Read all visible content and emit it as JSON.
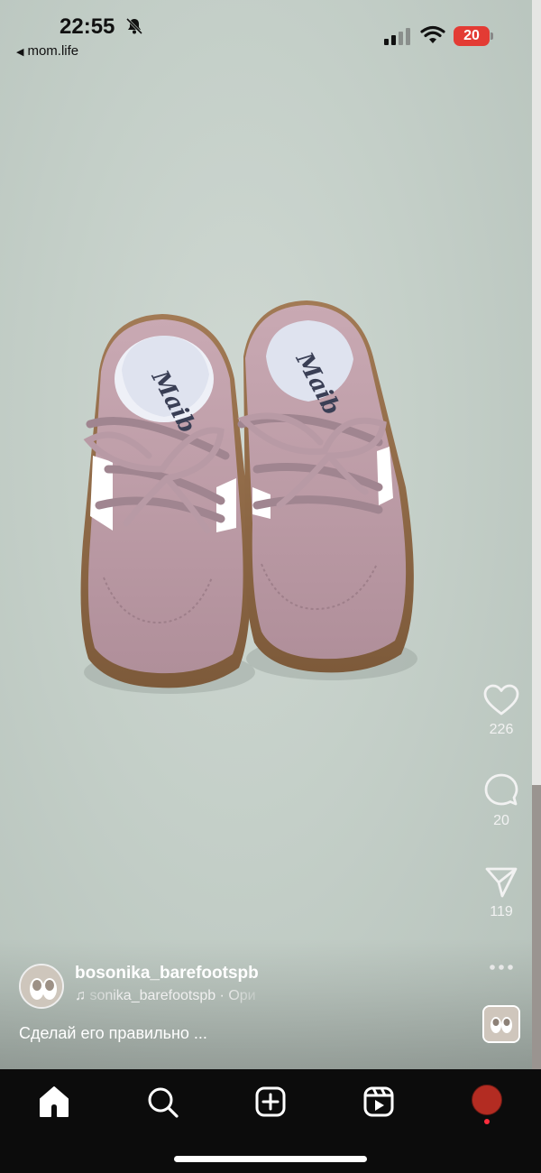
{
  "status_bar": {
    "time": "22:55",
    "back_label": "mom.life",
    "battery_level": "20",
    "battery_color": "#e33b34",
    "icons": [
      "bell-slash-icon",
      "signal-icon",
      "wifi-icon",
      "battery-icon"
    ]
  },
  "post": {
    "image_subject": "pink toddler sneakers with white stripes and gum sole",
    "actions": {
      "likes": "226",
      "comments": "20",
      "shares": "119"
    },
    "author": {
      "username": "bosonika_barefootspb"
    },
    "audio": {
      "text": "sonika_barefootspb · Ори"
    },
    "caption": "Сделай его правильно ..."
  },
  "bottom_nav": {
    "items": [
      "home-icon",
      "search-icon",
      "create-icon",
      "reels-icon",
      "profile-avatar"
    ],
    "profile_avatar_color": "#b32c22",
    "notification_dot_color": "#ff2d3d"
  }
}
